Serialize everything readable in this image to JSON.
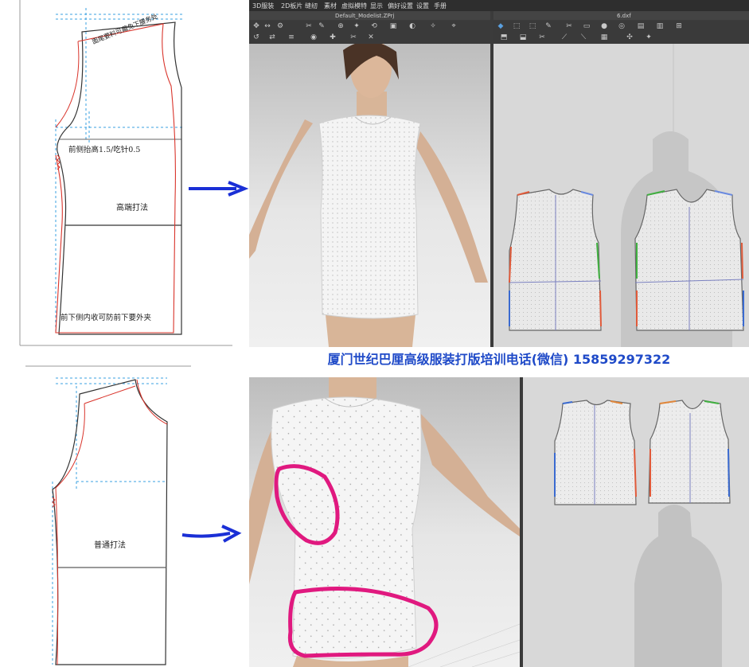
{
  "top_section": {
    "pattern_notes": {
      "shoulder_note": "面尾要料可藏免下腰务处",
      "side_note": "前侧抬高1.5/吃针0.5",
      "method": "高端打法",
      "hem_note": "前下侧内收可防前下要外夹"
    },
    "app": {
      "menu": [
        "3D服装",
        "2D板片",
        "缝纫",
        "素材",
        "虚拟模特",
        "显示",
        "偏好设置",
        "设置",
        "手册"
      ],
      "window_3d_title": "Default_Modelist.ZPrj",
      "window_2d_title": "6.dxf"
    }
  },
  "banner_text": "厦门世纪巴厘高级服装打版培训电话(微信) 15859297322",
  "bottom_section": {
    "pattern_notes": {
      "method": "普通打法"
    }
  },
  "colors": {
    "banner": "#1f4ac8",
    "arrow": "#1a2fd6",
    "circle": "#e0197f",
    "pattern_red": "#d9342b",
    "pattern_dash": "#3aa0e0"
  },
  "icons": {
    "arrow": "right-arrow-icon",
    "toolbar": "tool-icon"
  }
}
